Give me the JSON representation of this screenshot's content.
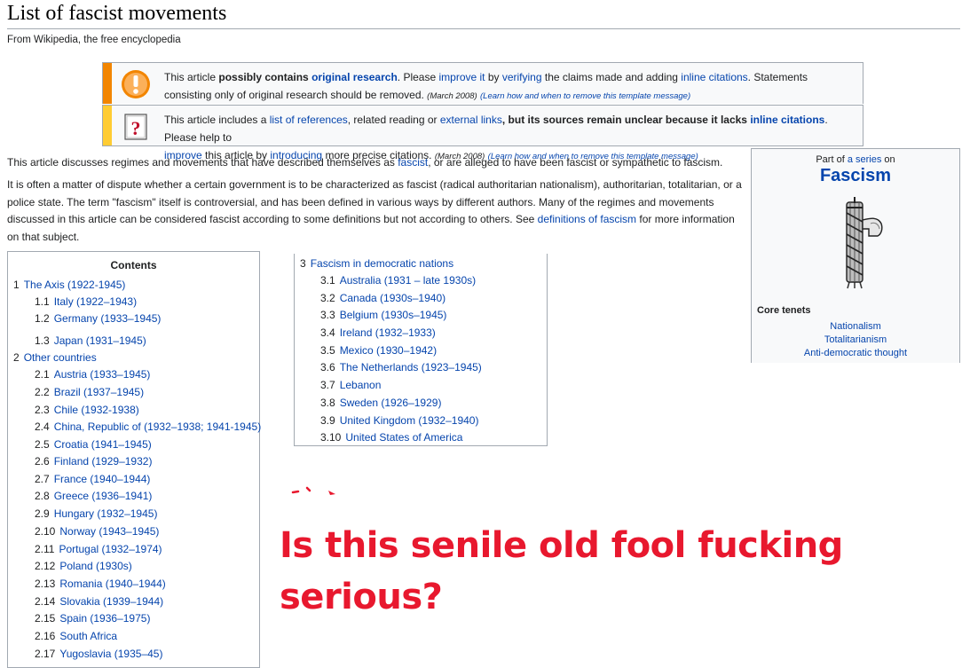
{
  "page": {
    "title": "List of fascist movements",
    "tagline": "From Wikipedia, the free encyclopedia"
  },
  "ambox_1": {
    "icon": "orange-exclamation-icon",
    "t1": "This article ",
    "t2": "possibly contains ",
    "t3": "original research",
    "t4": ". Please ",
    "t5": "improve it",
    "t6": " by ",
    "t7": "verifying",
    "t8": " the claims made and adding ",
    "t9": "inline citations",
    "t10": ". Statements consisting only of original research should be removed. ",
    "date": "(March 2008)",
    "learn": "(Learn how and when to remove this template message)"
  },
  "ambox_2": {
    "icon": "question-book-icon",
    "t1": "This article includes a ",
    "t2": "list of references",
    "t3": ", related reading or ",
    "t4": "external links",
    "t5": ", but its sources remain unclear because it lacks ",
    "t6": "inline citations",
    "t7": ". Please help to ",
    "t8": "improve",
    "t9": " this article by ",
    "t10": "introducing",
    "t11": " more precise citations. ",
    "date": "(March 2008)",
    "learn": "(Learn how and when to remove this template message)"
  },
  "para_1": {
    "a": "This article discusses regimes and movements that have described themselves as ",
    "link": "fascist",
    "b": ", or are alleged to have been fascist or sympathetic to fascism."
  },
  "para_2": {
    "a": "It is often a matter of dispute whether a certain government is to be characterized as fascist (radical authoritarian nationalism), authoritarian, totalitarian, or a police state. The term \"fascism\" itself is controversial, and has been defined in various ways by different authors. Many of the regimes and movements discussed in this article can be considered fascist according to some definitions but not according to others. See ",
    "link": "definitions of fascism",
    "b": " for more information on that subject."
  },
  "infobox": {
    "partof_a": "Part of ",
    "partof_link": "a series",
    "partof_b": " on",
    "title": "Fascism",
    "image_icon": "fasces-icon",
    "core_label": "Core tenets",
    "tenets": [
      "Nationalism",
      "Totalitarianism",
      "Anti-democratic thought"
    ]
  },
  "toc": {
    "title": "Contents",
    "left_items": [
      {
        "num": "1",
        "label": "The Axis (1922-1945)"
      },
      {
        "num": "1.1",
        "label": "Italy (1922–1943)"
      },
      {
        "num": "1.2",
        "label": "Germany (1933–1945)"
      },
      {
        "num": "1.3",
        "label": "Japan (1931–1945)"
      },
      {
        "num": "2",
        "label": "Other countries"
      },
      {
        "num": "2.1",
        "label": "Austria (1933–1945)"
      },
      {
        "num": "2.2",
        "label": "Brazil (1937–1945)"
      },
      {
        "num": "2.3",
        "label": "Chile (1932-1938)"
      },
      {
        "num": "2.4",
        "label": "China, Republic of (1932–1938; 1941-1945)"
      },
      {
        "num": "2.5",
        "label": "Croatia (1941–1945)"
      },
      {
        "num": "2.6",
        "label": "Finland (1929–1932)"
      },
      {
        "num": "2.7",
        "label": "France (1940–1944)"
      },
      {
        "num": "2.8",
        "label": "Greece (1936–1941)"
      },
      {
        "num": "2.9",
        "label": "Hungary (1932–1945)"
      },
      {
        "num": "2.10",
        "label": "Norway (1943–1945)"
      },
      {
        "num": "2.11",
        "label": "Portugal (1932–1974)"
      },
      {
        "num": "2.12",
        "label": "Poland (1930s)"
      },
      {
        "num": "2.13",
        "label": "Romania (1940–1944)"
      },
      {
        "num": "2.14",
        "label": "Slovakia (1939–1944)"
      },
      {
        "num": "2.15",
        "label": "Spain (1936–1975)"
      },
      {
        "num": "2.16",
        "label": "South Africa"
      },
      {
        "num": "2.17",
        "label": "Yugoslavia (1935–45)"
      }
    ],
    "right_items": [
      {
        "num": "3",
        "label": "Fascism in democratic nations"
      },
      {
        "num": "3.1",
        "label": "Australia (1931 – late 1930s)"
      },
      {
        "num": "3.2",
        "label": "Canada (1930s–1940)"
      },
      {
        "num": "3.3",
        "label": "Belgium (1930s–1945)"
      },
      {
        "num": "3.4",
        "label": "Ireland (1932–1933)"
      },
      {
        "num": "3.5",
        "label": "Mexico (1930–1942)"
      },
      {
        "num": "3.6",
        "label": "The Netherlands (1923–1945)"
      },
      {
        "num": "3.7",
        "label": "Lebanon"
      },
      {
        "num": "3.8",
        "label": "Sweden (1926–1929)"
      },
      {
        "num": "3.9",
        "label": "United Kingdom (1932–1940)"
      },
      {
        "num": "3.10",
        "label": "United States of America"
      }
    ]
  },
  "caption": {
    "line1": "Is this senile old fool fucking",
    "line2": "serious?",
    "color": "#e8182e"
  }
}
